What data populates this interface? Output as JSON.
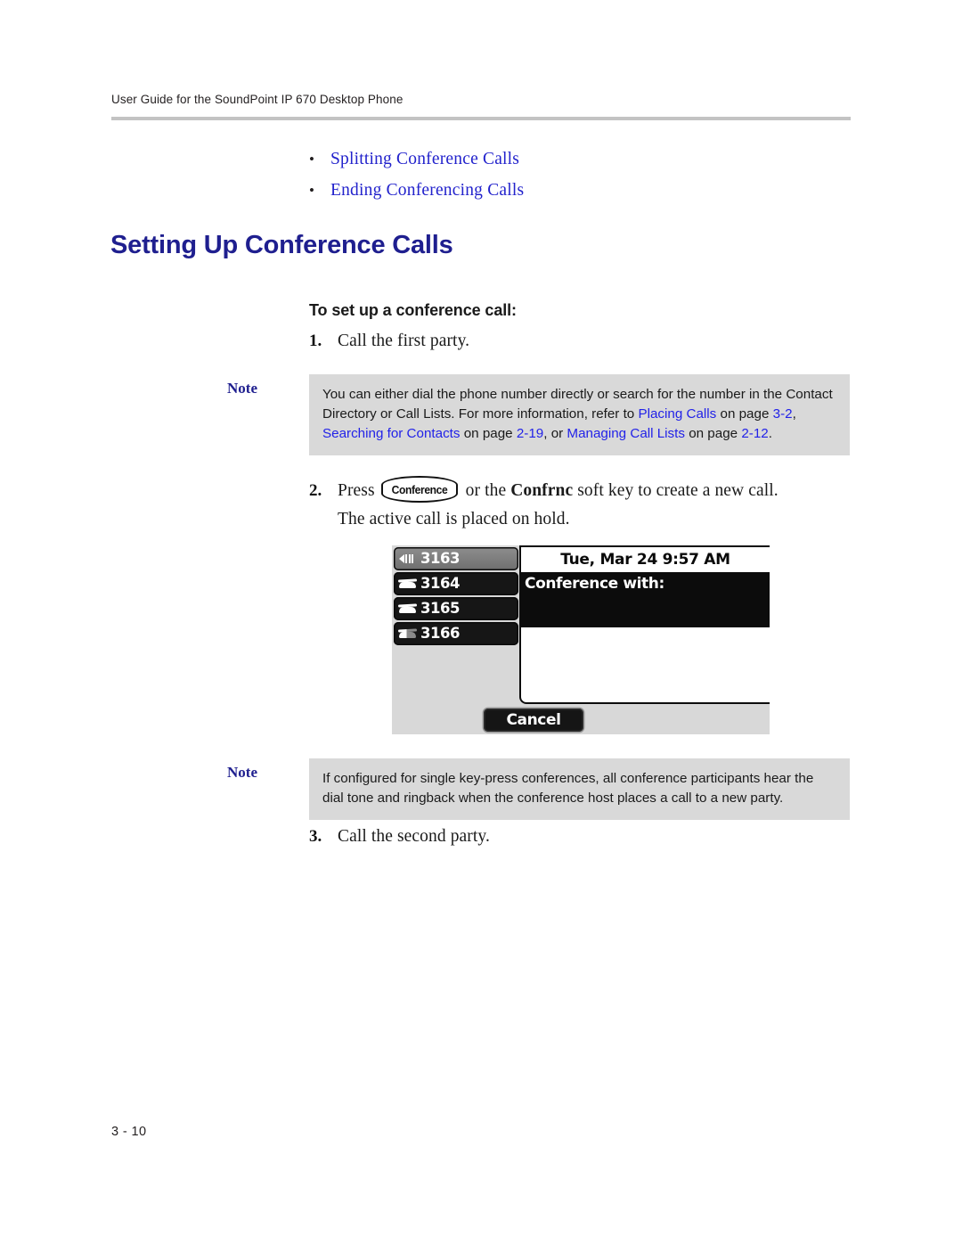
{
  "header": {
    "running_title": "User Guide for the SoundPoint IP 670 Desktop Phone"
  },
  "bullets": [
    {
      "label": "Splitting Conference Calls"
    },
    {
      "label": "Ending Conferencing Calls"
    }
  ],
  "heading": "Setting Up Conference Calls",
  "procedure": {
    "title": "To set up a conference call:",
    "steps": [
      {
        "num": "1.",
        "text": "Call the first party."
      },
      {
        "num": "2.",
        "press_word": "Press",
        "keycap_label": "Conference",
        "text_after_key": "or the",
        "softkey_name": "Confrnc",
        "text_tail": "soft key to create a new call.",
        "continuation": "The active call is placed on hold."
      },
      {
        "num": "3.",
        "text": "Call the second party."
      }
    ]
  },
  "notes": [
    {
      "label": "Note",
      "segments": [
        {
          "t": "You can either dial the phone number directly or search for the number in the Contact Directory or Call Lists. For more information, refer to ",
          "link": false
        },
        {
          "t": "Placing Calls",
          "link": true
        },
        {
          "t": " on page ",
          "link": false
        },
        {
          "t": "3-2",
          "link": true
        },
        {
          "t": ", ",
          "link": false
        },
        {
          "t": "Searching for Contacts",
          "link": true
        },
        {
          "t": " on page ",
          "link": false
        },
        {
          "t": "2-19",
          "link": true
        },
        {
          "t": ", or ",
          "link": false
        },
        {
          "t": "Managing Call Lists",
          "link": true
        },
        {
          "t": " on page ",
          "link": false
        },
        {
          "t": "2-12",
          "link": true
        },
        {
          "t": ".",
          "link": false
        }
      ]
    },
    {
      "label": "Note",
      "segments": [
        {
          "t": "If configured for single key-press conferences, all conference participants hear the dial tone and ringback when the conference host places a call to a new party.",
          "link": false
        }
      ]
    }
  ],
  "phone_screen": {
    "line_keys": [
      {
        "label": "3163",
        "icon": "speaker-icon",
        "state": "grey"
      },
      {
        "label": "3164",
        "icon": "handset-icon",
        "state": "dark"
      },
      {
        "label": "3165",
        "icon": "handset-icon",
        "state": "dark"
      },
      {
        "label": "3166",
        "icon": "handset-half-icon",
        "state": "dark"
      }
    ],
    "status_bar": "Tue, Mar 24  9:57 AM",
    "prompt": "Conference with:",
    "soft_keys": [
      {
        "label": "Cancel"
      }
    ]
  },
  "footer": {
    "page_number": "3 - 10"
  },
  "colors": {
    "heading_blue": "#1f1f8f",
    "link_blue": "#2222e8",
    "note_bg": "#d9d9d9",
    "rule_grey": "#c3c3c3"
  }
}
